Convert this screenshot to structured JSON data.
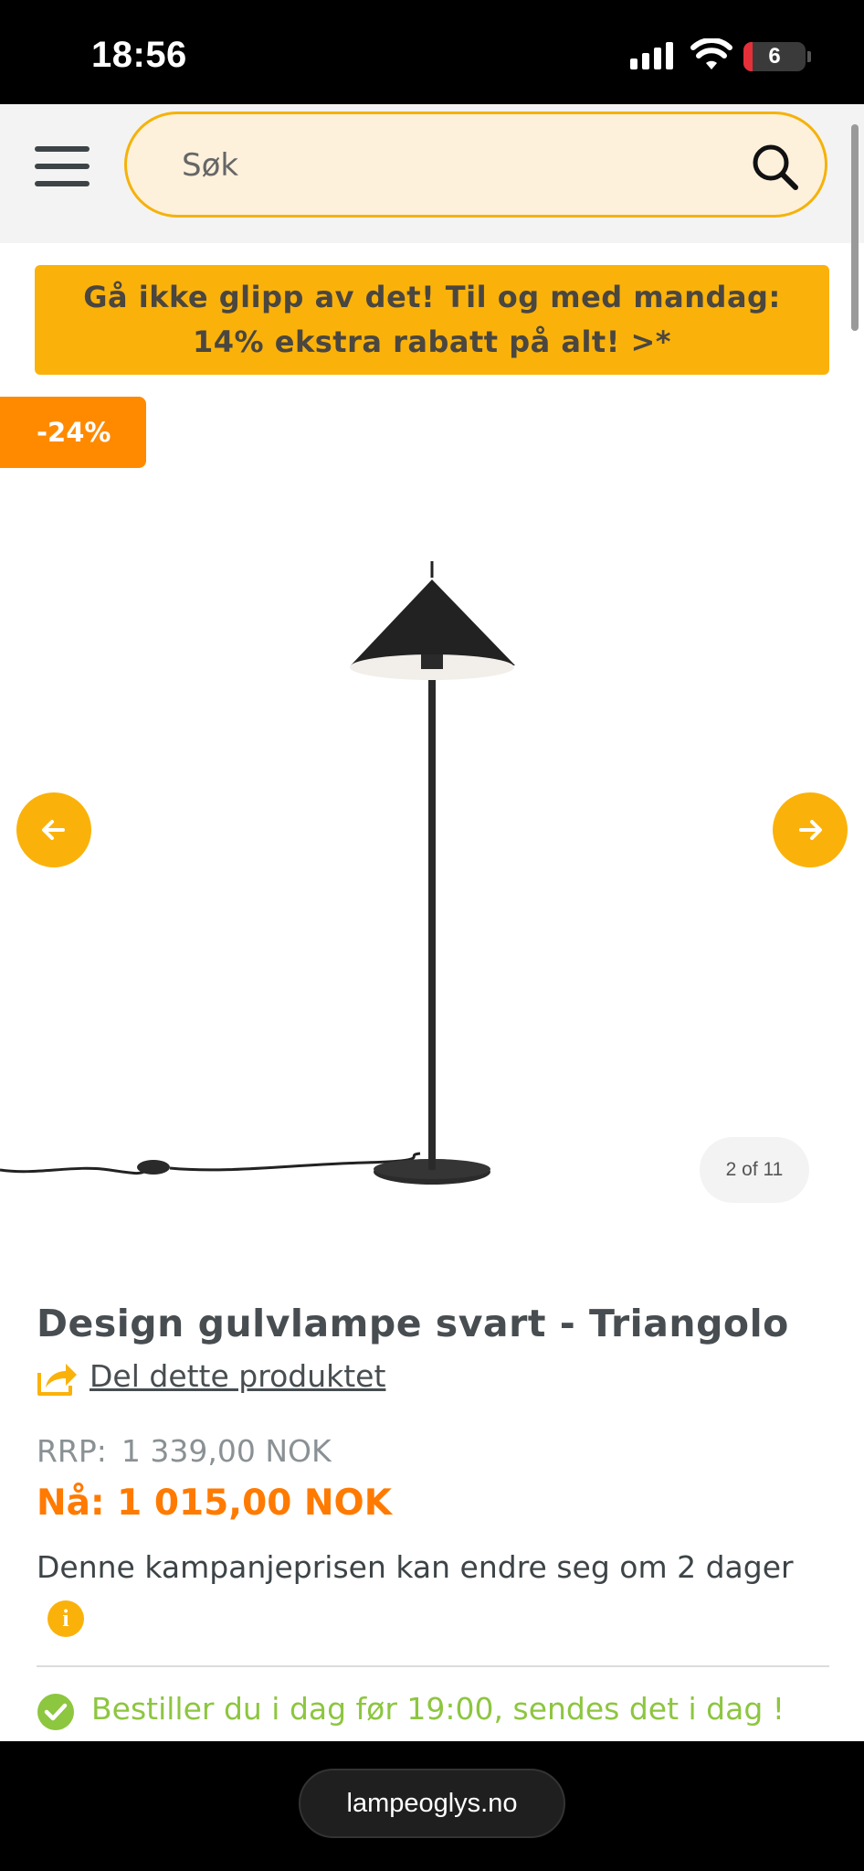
{
  "status_bar": {
    "time": "18:56",
    "battery": "6",
    "icons": [
      "cellular-signal-icon",
      "wifi-icon",
      "battery-icon"
    ]
  },
  "header": {
    "search_placeholder": "Søk",
    "icons": [
      "hamburger-menu-icon",
      "search-icon"
    ]
  },
  "promo_banner": {
    "line1": "Gå ikke glipp av det! Til og med mandag:",
    "line2": "14% ekstra rabatt på alt! >*"
  },
  "discount_badge": "-24%",
  "gallery": {
    "counter": "2 of 11",
    "icons": [
      "arrow-left-icon",
      "arrow-right-icon"
    ]
  },
  "product": {
    "title": "Design gulvlampe svart - Triangolo",
    "share_label": "Del dette produktet",
    "rrp_label": "RRP:",
    "rrp_value": "1 339,00 NOK",
    "now_price": "Nå: 1 015,00 NOK",
    "campaign_text": "Denne kampanjeprisen kan endre seg om 2 dager",
    "info_icon_glyph": "i",
    "shipping_text": "Bestiller du i dag før 19:00, sendes det i dag !"
  },
  "browser": {
    "url": "lampeoglys.no"
  },
  "colors": {
    "accent_yellow": "#fab20a",
    "discount_orange": "#ff8a00",
    "price_orange": "#ff7a00",
    "shipping_green": "#8dc63f",
    "text_dark": "#474d50"
  }
}
